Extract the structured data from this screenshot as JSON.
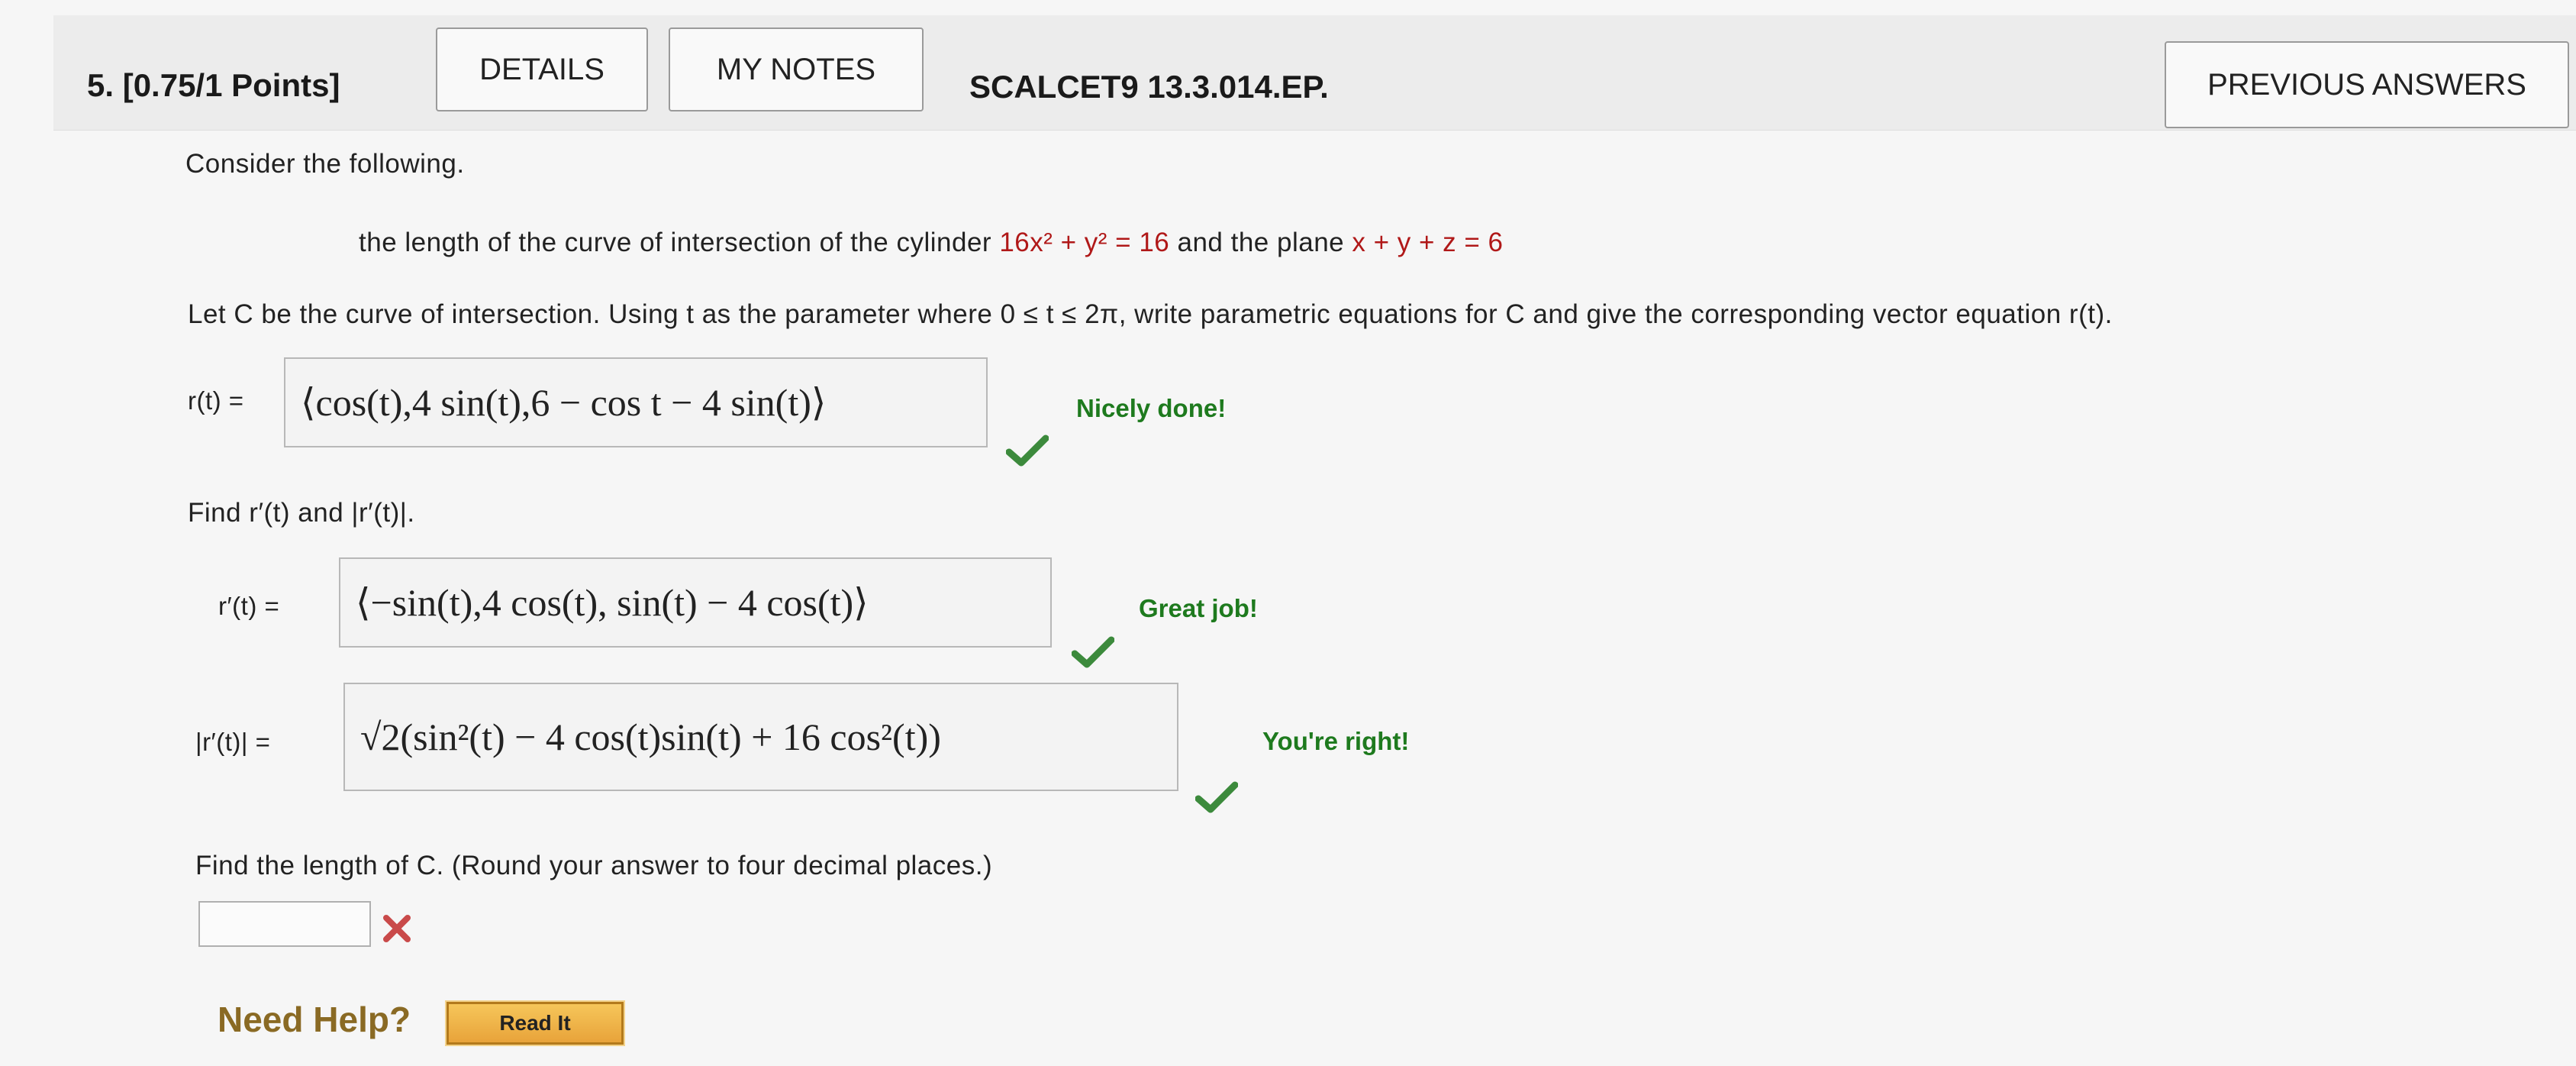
{
  "header": {
    "question_number": "5.",
    "points": "[0.75/1 Points]",
    "details_label": "DETAILS",
    "my_notes_label": "MY NOTES",
    "problem_id": "SCALCET9 13.3.014.EP.",
    "previous_answers_label": "PREVIOUS ANSWERS"
  },
  "problem": {
    "intro": "Consider the following.",
    "statement_prefix": "the length of the curve of intersection of the cylinder ",
    "statement_eq1": "16x² + y² = 16",
    "statement_mid": " and the plane ",
    "statement_eq2": "x + y + z = 6",
    "instruction": "Let C be the curve of intersection. Using t as the parameter where 0 ≤ t ≤ 2π, write parametric equations for C and give the corresponding vector equation r(t).",
    "r_label": "r(t) =",
    "r_answer": "⟨cos(t),4 sin(t),6 − cos t − 4 sin(t)⟩",
    "r_feedback": "Nicely done!",
    "find_derivative": "Find r′(t) and |r′(t)|.",
    "rprime_label": "r′(t) =",
    "rprime_answer": "⟨−sin(t),4 cos(t), sin(t) − 4 cos(t)⟩",
    "rprime_feedback": "Great job!",
    "rprime_mag_label": "|r′(t)| =",
    "rprime_mag_answer": "√2(sin²(t) − 4 cos(t)sin(t) + 16 cos²(t))",
    "rprime_mag_feedback": "You're right!",
    "find_length": "Find the length of C. (Round your answer to four decimal places.)",
    "length_value": ""
  },
  "help": {
    "need_help_label": "Need Help?",
    "read_it_label": "Read It"
  },
  "colors": {
    "correct": "#1e7a1e",
    "incorrect": "#c94a4a",
    "math_red": "#b01818",
    "read_it_bg": "#f0b44a"
  },
  "icons": {
    "check": "check-icon",
    "incorrect": "x-icon"
  }
}
